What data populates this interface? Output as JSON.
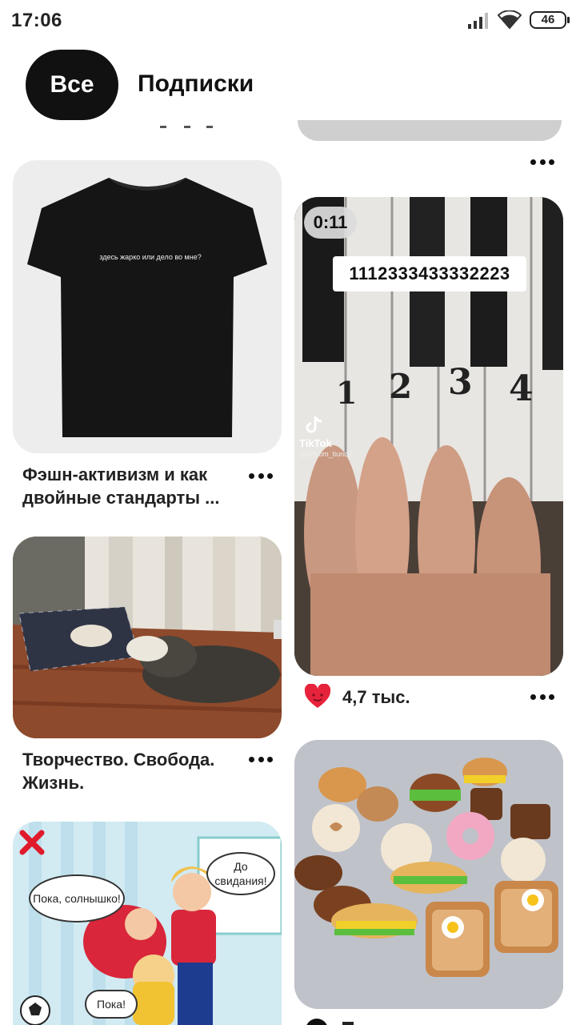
{
  "status_bar": {
    "time": "17:06",
    "battery": "46"
  },
  "tabs": {
    "active": "Все",
    "inactive": "Подписки"
  },
  "pins": {
    "tshirt": {
      "shirt_text": "здесь жарко или дело во мне?",
      "title": "Фэшн-активизм и как двойные стандарты ..."
    },
    "dog": {
      "title": "Творчество. Свобода. Жизнь."
    },
    "piano": {
      "duration": "0:11",
      "numbers": "1112333433332223",
      "tiktok": "TikTok",
      "tiktok_user": "@artyom_tiunov",
      "likes": "4,7 тыс.",
      "keys": [
        "1",
        "2",
        "3",
        "4"
      ]
    },
    "cartoon": {
      "bubble_left": "Пока, солнышко!",
      "bubble_right": "До свидания!",
      "bubble_child": "Пока!"
    }
  },
  "colors": {
    "accent": "#111111",
    "heart": "#e6233b"
  }
}
